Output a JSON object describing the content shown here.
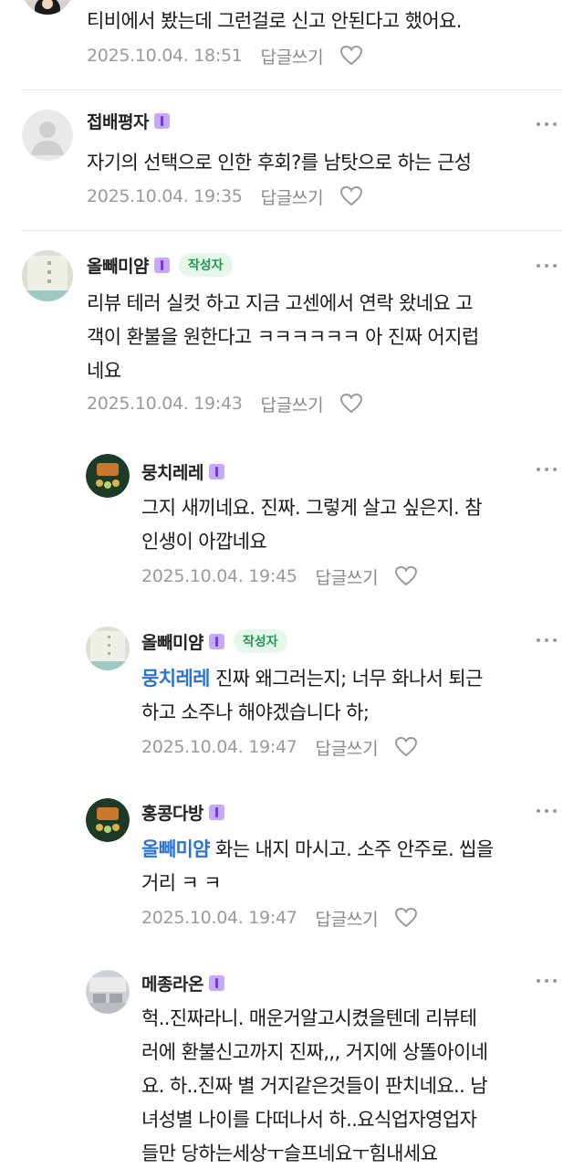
{
  "colors": {
    "mention": "#2b73d6",
    "author_badge_bg": "#e4f7ea",
    "author_badge_text": "#1c9c4f",
    "level_badge": "#c6a9ff",
    "meta_gray": "#9a9a9a"
  },
  "comments": [
    {
      "text": "티비에서 봤는데 그런걸로 신고 안된다고 했어요.",
      "date": "2025.10.04. 18:51",
      "reply_label": "답글쓰기"
    },
    {
      "nickname": "접배평자",
      "text": "자기의 선택으로 인한 후회?를 남탓으로 하는 근성",
      "date": "2025.10.04. 19:35",
      "reply_label": "답글쓰기"
    },
    {
      "nickname": "올빼미얌",
      "author_badge": "작성자",
      "text_lines": [
        "리뷰 테러 실컷 하고 지금 고센에서 연락 왔네요 고",
        "객이 환불을 원한다고 ㅋㅋㅋㅋㅋㅋ 아 진짜 어지럽",
        "네요"
      ],
      "date": "2025.10.04. 19:43",
      "reply_label": "답글쓰기"
    },
    {
      "nickname": "뭉치레레",
      "text_lines": [
        "그지 새끼네요. 진짜. 그렇게 살고 싶은지. 참",
        "인생이 아깝네요"
      ],
      "date": "2025.10.04. 19:45",
      "reply_label": "답글쓰기"
    },
    {
      "nickname": "올빼미얌",
      "author_badge": "작성자",
      "mention": "뭉치레레",
      "text_lines": [
        " 진짜 왜그러는지; 너무 화나서 퇴근",
        "하고 소주나 해야겠습니다 하;"
      ],
      "date": "2025.10.04. 19:47",
      "reply_label": "답글쓰기"
    },
    {
      "nickname": "홍콩다방",
      "mention": "올빼미얌",
      "text_lines": [
        " 화는 내지 마시고. 소주 안주로. 씹을",
        "거리 ㅋ ㅋ"
      ],
      "date": "2025.10.04. 19:47",
      "reply_label": "답글쓰기"
    },
    {
      "nickname": "메종라온",
      "text_lines": [
        "헉..진짜라니. 매운거알고시켰을텐데 리뷰테",
        "러에 환불신고까지 진짜,,, 거지에 상똘아이네",
        "요. 하..진짜 별 거지같은것들이 판치네요.. 남",
        "녀성별 나이를 다떠나서 하..요식업자영업자",
        "들만 당하는세상ㅜ슬프네요ㅜ힘내세요"
      ]
    }
  ]
}
